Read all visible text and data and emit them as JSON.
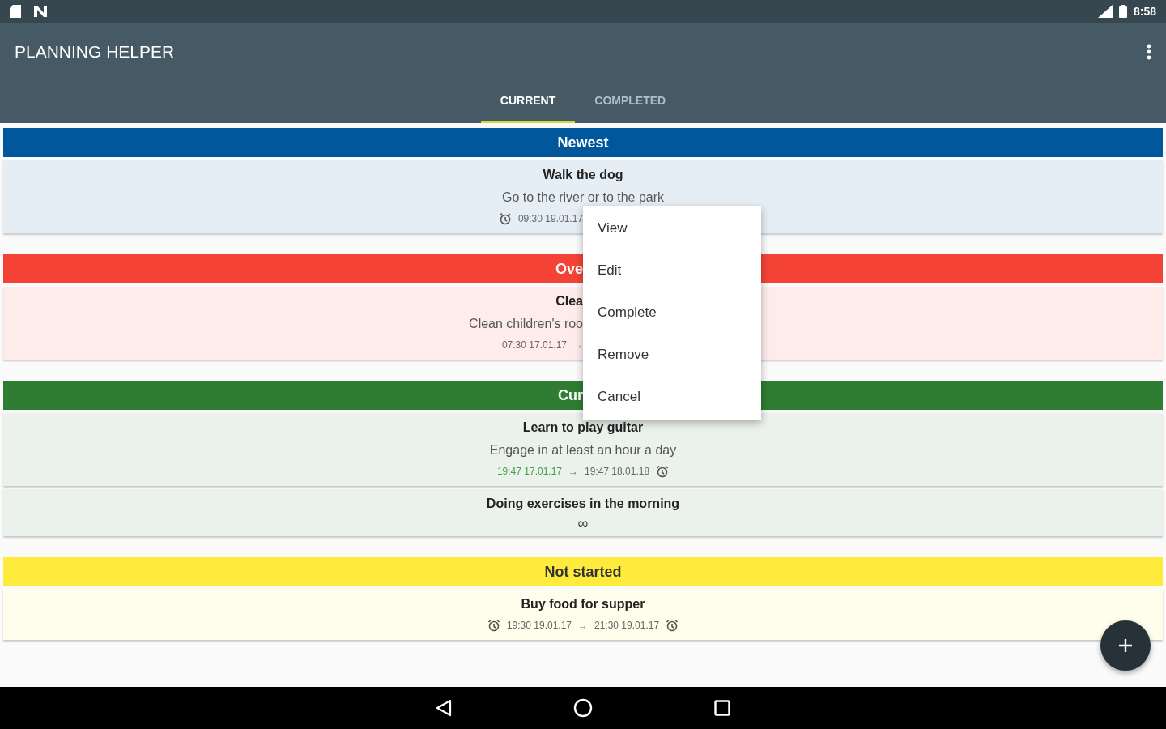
{
  "status_bar": {
    "time": "8:58"
  },
  "app_bar": {
    "title": "PLANNING HELPER"
  },
  "tabs": [
    {
      "label": "CURRENT",
      "selected": true
    },
    {
      "label": "COMPLETED",
      "selected": false
    }
  ],
  "sections": [
    {
      "title": {
        "text": "Newest",
        "covered": false
      },
      "color": "#01579b",
      "items": [
        {
          "title": {
            "text": "Walk the dog",
            "covered": false
          },
          "description": {
            "text": "Go to the river or to the park",
            "covered": false
          },
          "time": {
            "covered": true,
            "parts": [
              {
                "kind": "alarm"
              },
              {
                "kind": "time",
                "text": "09:30 19.01.17",
                "active": false
              }
            ]
          }
        }
      ]
    },
    {
      "title": {
        "text": "Ove",
        "covered": true
      },
      "color": "#f44336",
      "items": [
        {
          "title": {
            "text": "Clea",
            "covered": true
          },
          "description": {
            "text": "Clean children's roo",
            "covered": true
          },
          "time": {
            "covered": true,
            "parts": [
              {
                "kind": "time",
                "text": "07:30 17.01.17",
                "active": false
              },
              {
                "kind": "arrow",
                "text": "→"
              }
            ]
          }
        }
      ]
    },
    {
      "title": {
        "text": "Cur",
        "covered": true
      },
      "color": "#2e7d32",
      "items": [
        {
          "title": {
            "text": "Learn to play guitar",
            "covered": false
          },
          "description": {
            "text": "Engage in at least an hour a day",
            "covered": false
          },
          "time": {
            "covered": false,
            "parts": [
              {
                "kind": "time",
                "text": "19:47 17.01.17",
                "active": true
              },
              {
                "kind": "arrow",
                "text": "→"
              },
              {
                "kind": "time",
                "text": "19:47 18.01.18",
                "active": false
              },
              {
                "kind": "alarm"
              }
            ]
          }
        },
        {
          "title": {
            "text": "Doing exercises  in the morning",
            "covered": false
          },
          "time": {
            "covered": false,
            "parts": [
              {
                "kind": "infinity",
                "text": "∞"
              }
            ]
          }
        }
      ]
    },
    {
      "title": {
        "text": "Not started",
        "covered": false
      },
      "color": "#ffeb3b",
      "items": [
        {
          "title": {
            "text": "Buy food for supper",
            "covered": false
          },
          "time": {
            "covered": false,
            "parts": [
              {
                "kind": "alarm"
              },
              {
                "kind": "time",
                "text": "19:30 19.01.17",
                "active": false
              },
              {
                "kind": "arrow",
                "text": "→"
              },
              {
                "kind": "time",
                "text": "21:30 19.01.17",
                "active": false
              },
              {
                "kind": "alarm"
              }
            ]
          }
        }
      ]
    }
  ],
  "context_menu": {
    "items": [
      "View",
      "Edit",
      "Complete",
      "Remove",
      "Cancel"
    ]
  }
}
